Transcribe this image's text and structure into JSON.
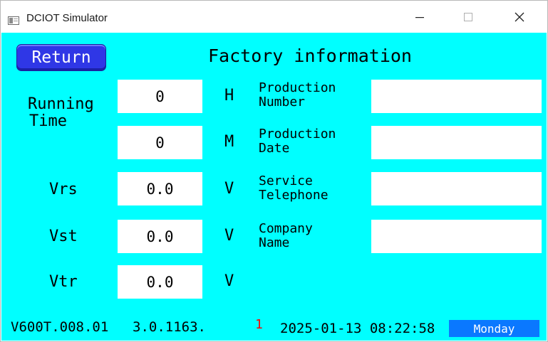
{
  "window": {
    "title": "DCIOT Simulator"
  },
  "screen": {
    "return_label": "Return",
    "page_title": "Factory information",
    "running_time": {
      "label_line1": "Running",
      "label_line2": "Time",
      "hours": "0",
      "hours_unit": "H",
      "minutes": "0",
      "minutes_unit": "M"
    },
    "voltages": [
      {
        "label": "Vrs",
        "value": "0.0",
        "unit": "V"
      },
      {
        "label": "Vst",
        "value": "0.0",
        "unit": "V"
      },
      {
        "label": "Vtr",
        "value": "0.0",
        "unit": "V"
      }
    ],
    "info_fields": [
      {
        "line1": "Production",
        "line2": "Number",
        "value": ""
      },
      {
        "line1": "Production",
        "line2": "Date",
        "value": ""
      },
      {
        "line1": "Service",
        "line2": "Telephone",
        "value": ""
      },
      {
        "line1": "Company",
        "line2": "Name",
        "value": ""
      }
    ],
    "status_bar": {
      "firmware": "V600T.008.01",
      "version": "3.0.1163.",
      "indicator": "1",
      "indicator_color": "#ff0000",
      "datetime": "2025-01-13 08:22:58",
      "day": "Monday"
    }
  },
  "colors": {
    "background": "#00ffff",
    "button": "#2f37e6",
    "day_badge": "#0a78ff"
  }
}
